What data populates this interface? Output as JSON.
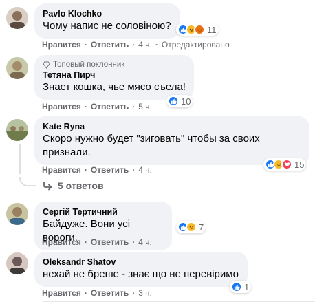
{
  "comments": [
    {
      "author": "Pavlo Klochko",
      "text": "Чому напис не соловіною?",
      "actions": {
        "like": "Нравится",
        "reply": "Ответить",
        "time": "4 ч.",
        "edited": "Отредактировано"
      },
      "reactions": {
        "types": [
          "like",
          "haha",
          "angry"
        ],
        "count": "11"
      },
      "avatar_color": "#8b6f5a"
    },
    {
      "badge": "Топовый поклонник",
      "author": "Тетяна Пирч",
      "text": "Знает кошка, чье мясо съела!",
      "actions": {
        "like": "Нравится",
        "reply": "Ответить",
        "time": "5 ч."
      },
      "reactions": {
        "types": [
          "like"
        ],
        "count": "10"
      },
      "avatar_color": "#a58c6a"
    },
    {
      "author": "Kate Ryna",
      "text": "Скоро нужно будет \"зиговать\" чтобы за своих признали.",
      "actions": {
        "like": "Нравится",
        "reply": "Ответить",
        "time": "4 ч."
      },
      "reactions": {
        "types": [
          "like",
          "haha",
          "love"
        ],
        "count": "15"
      },
      "avatar_color": "#7f8b5c"
    },
    {
      "author": "Сергій Тертичний",
      "text": "Байдуже. Вони усі вороги.",
      "actions": {
        "like": "Нравится",
        "reply": "Ответить",
        "time": "4 ч."
      },
      "reactions": {
        "types": [
          "like",
          "haha"
        ],
        "count": "7"
      },
      "avatar_color": "#9a9a70"
    },
    {
      "author": "Oleksandr Shatov",
      "text": "нехай не бреше - знає що не перевіримо",
      "actions": {
        "like": "Нравится",
        "reply": "Ответить",
        "time": "3 ч."
      },
      "reactions": {
        "types": [
          "like"
        ],
        "count": "1"
      },
      "avatar_color": "#6b5a57"
    }
  ],
  "replies": {
    "label": "5 ответов"
  },
  "colors": {
    "like": "#1877f2",
    "haha": "#f7b928",
    "love": "#f33e58",
    "bubble": "#f0f2f5",
    "meta": "#65676b"
  }
}
